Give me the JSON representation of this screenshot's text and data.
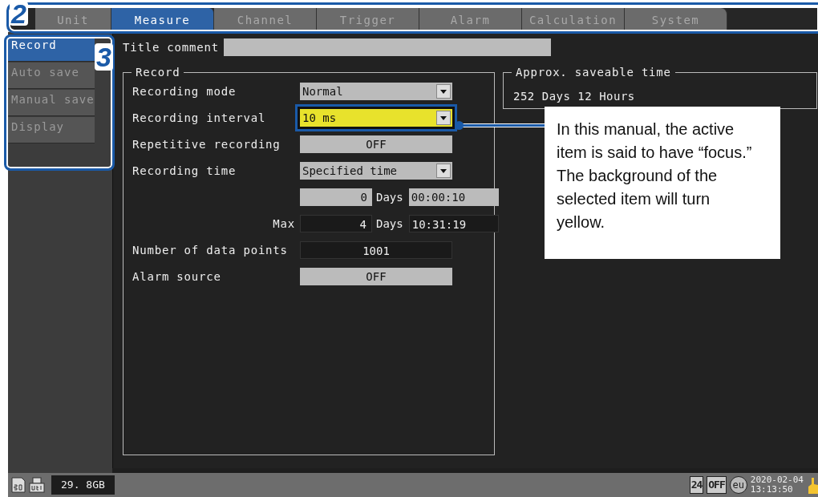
{
  "tab_bar_callout": "2",
  "menu_callout": "3",
  "tabs": [
    {
      "label": "Unit",
      "selected": false
    },
    {
      "label": "Measure",
      "selected": true
    },
    {
      "label": "Channel",
      "selected": false
    },
    {
      "label": "Trigger",
      "selected": false
    },
    {
      "label": "Alarm",
      "selected": false
    },
    {
      "label": "Calculation",
      "selected": false
    },
    {
      "label": "System",
      "selected": false
    }
  ],
  "sidebar": {
    "items": [
      {
        "label": "Record",
        "selected": true
      },
      {
        "label": "Auto save",
        "selected": false
      },
      {
        "label": "Manual save",
        "selected": false
      },
      {
        "label": "Display",
        "selected": false
      }
    ]
  },
  "title_comment": {
    "label": "Title comment"
  },
  "record_group": {
    "title": "Record",
    "rows": [
      {
        "kind": "dropdown",
        "label": "Recording mode",
        "value": "Normal",
        "focused": false
      },
      {
        "kind": "dropdown",
        "label": "Recording interval",
        "value": "10 ms",
        "focused": true
      },
      {
        "kind": "button",
        "label": "Repetitive recording",
        "value": "OFF"
      },
      {
        "kind": "dropdown",
        "label": "Recording time",
        "value": "Specified time",
        "focused": false
      },
      {
        "kind": "duration",
        "days": "0",
        "unit": "Days",
        "time": "00:00:10",
        "editable": true
      },
      {
        "kind": "duration",
        "label": "Max",
        "days": "4",
        "unit": "Days",
        "time": "10:31:19",
        "editable": false
      },
      {
        "kind": "readout",
        "label": "Number of data points",
        "value": "1001"
      },
      {
        "kind": "button",
        "label": "Alarm source",
        "value": "OFF"
      }
    ]
  },
  "saveable_time": {
    "title": "Approx. saveable time",
    "value": "252 Days 12 Hours"
  },
  "note": "In this manual, the active item is said to have “focus.” The background of the selected item will turn yellow.",
  "status_bar": {
    "free_space": "29. 8GB",
    "clock_format": "24",
    "auto_setting": "OFF",
    "region": "eu",
    "date": "2020-02-04",
    "time": "13:13:50"
  }
}
